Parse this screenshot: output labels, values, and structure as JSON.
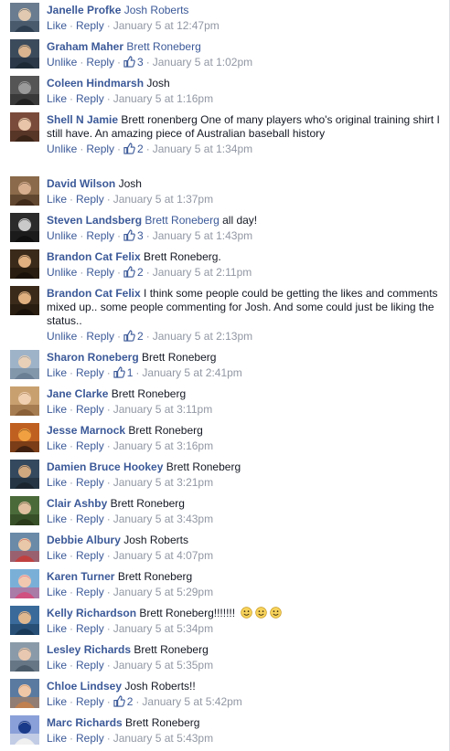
{
  "colors": {
    "link": "#3b5998",
    "meta": "#9197a3",
    "text": "#141823"
  },
  "comments": [
    {
      "author": "Janelle Profke",
      "mention": "Josh Roberts",
      "text": "",
      "action": "Like",
      "reply": "Reply",
      "likes": "",
      "time": "January 5 at 12:47pm",
      "avatar": [
        "#6a7c8f",
        "#e0c9b0",
        "#2c3e50"
      ]
    },
    {
      "author": "Graham Maher",
      "mention": "Brett Roneberg",
      "text": "",
      "action": "Unlike",
      "reply": "Reply",
      "likes": "3",
      "time": "January 5 at 1:02pm",
      "avatar": [
        "#3c4b5c",
        "#d9b48f",
        "#1d2a36"
      ]
    },
    {
      "author": "Coleen Hindmarsh",
      "mention": "",
      "text": "Josh",
      "action": "Like",
      "reply": "Reply",
      "likes": "",
      "time": "January 5 at 1:16pm",
      "avatar": [
        "#555555",
        "#9a9a9a",
        "#222222"
      ]
    },
    {
      "author": "Shell N Jamie",
      "mention": "",
      "text": "Brett ronenberg One of many players who's original training shirt I still have. An amazing piece of Australian baseball history",
      "action": "Unlike",
      "reply": "Reply",
      "likes": "2",
      "time": "January 5 at 1:34pm",
      "avatar": [
        "#7a4b3a",
        "#e8c4a8",
        "#3a2418"
      ]
    },
    {
      "author": "David Wilson",
      "mention": "",
      "text": "Josh",
      "action": "Like",
      "reply": "Reply",
      "likes": "",
      "time": "January 5 at 1:37pm",
      "avatar": [
        "#8a6a4a",
        "#d8b090",
        "#402a1a"
      ]
    },
    {
      "author": "Steven Landsberg",
      "mention": "Brett Roneberg",
      "text": "all day!",
      "action": "Unlike",
      "reply": "Reply",
      "likes": "3",
      "time": "January 5 at 1:43pm",
      "avatar": [
        "#2b2b2b",
        "#c9c9c9",
        "#0f0f0f"
      ]
    },
    {
      "author": "Brandon Cat Felix",
      "mention": "",
      "text": "Brett Roneberg.",
      "action": "Unlike",
      "reply": "Reply",
      "likes": "2",
      "time": "January 5 at 2:11pm",
      "avatar": [
        "#3a2a1a",
        "#e0b080",
        "#1a120a"
      ]
    },
    {
      "author": "Brandon Cat Felix",
      "mention": "",
      "text": "I think some people could be getting the likes and comments mixed up.. some people commenting for Josh. And some could just be liking the status..",
      "action": "Unlike",
      "reply": "Reply",
      "likes": "2",
      "time": "January 5 at 2:13pm",
      "avatar": [
        "#3a2a1a",
        "#e0b080",
        "#1a120a"
      ]
    },
    {
      "author": "Sharon Roneberg",
      "mention": "",
      "text": "Brett Roneberg",
      "action": "Like",
      "reply": "Reply",
      "likes": "1",
      "time": "January 5 at 2:41pm",
      "avatar": [
        "#9fb3c8",
        "#e8d0b8",
        "#6b7f94"
      ]
    },
    {
      "author": "Jane Clarke",
      "mention": "",
      "text": "Brett Roneberg",
      "action": "Like",
      "reply": "Reply",
      "likes": "",
      "time": "January 5 at 3:11pm",
      "avatar": [
        "#c8a070",
        "#f0d0b0",
        "#8a6038"
      ]
    },
    {
      "author": "Jesse Marnock",
      "mention": "",
      "text": "Brett Roneberg",
      "action": "Like",
      "reply": "Reply",
      "likes": "",
      "time": "January 5 at 3:16pm",
      "avatar": [
        "#c06020",
        "#f0a040",
        "#402010"
      ]
    },
    {
      "author": "Damien Bruce Hookey",
      "mention": "",
      "text": "Brett Roneberg",
      "action": "Like",
      "reply": "Reply",
      "likes": "",
      "time": "January 5 at 3:21pm",
      "avatar": [
        "#34495e",
        "#d0a880",
        "#1a252f"
      ]
    },
    {
      "author": "Clair Ashby",
      "mention": "",
      "text": "Brett Roneberg",
      "action": "Like",
      "reply": "Reply",
      "likes": "",
      "time": "January 5 at 3:43pm",
      "avatar": [
        "#4a6a3a",
        "#e0c0a0",
        "#2a3a1a"
      ]
    },
    {
      "author": "Debbie Albury",
      "mention": "",
      "text": "Josh Roberts",
      "action": "Like",
      "reply": "Reply",
      "likes": "",
      "time": "January 5 at 4:07pm",
      "avatar": [
        "#6a8aa8",
        "#e8c8a8",
        "#c04040"
      ]
    },
    {
      "author": "Karen Turner",
      "mention": "",
      "text": "Brett Roneberg",
      "action": "Like",
      "reply": "Reply",
      "likes": "",
      "time": "January 5 at 5:29pm",
      "avatar": [
        "#7ab0d8",
        "#f0c8b0",
        "#d05080"
      ]
    },
    {
      "author": "Kelly Richardson",
      "mention": "",
      "text": "Brett Roneberg!!!!!!!",
      "action": "Like",
      "reply": "Reply",
      "likes": "",
      "time": "January 5 at 5:34pm",
      "emojis": 3,
      "avatar": [
        "#3a6a9a",
        "#e0b890",
        "#1a3a5a"
      ]
    },
    {
      "author": "Lesley Richards",
      "mention": "",
      "text": "Brett Roneberg",
      "action": "Like",
      "reply": "Reply",
      "likes": "",
      "time": "January 5 at 5:35pm",
      "avatar": [
        "#8a9aa8",
        "#e8c8b0",
        "#4a5a68"
      ]
    },
    {
      "author": "Chloe Lindsey",
      "mention": "",
      "text": "Josh Roberts!!",
      "action": "Like",
      "reply": "Reply",
      "likes": "2",
      "time": "January 5 at 5:42pm",
      "avatar": [
        "#5a7aa0",
        "#f0c8a8",
        "#c08050"
      ]
    },
    {
      "author": "Marc Richards",
      "mention": "",
      "text": "Brett Roneberg",
      "action": "Like",
      "reply": "Reply",
      "likes": "",
      "time": "January 5 at 5:43pm",
      "avatar": [
        "#8aa0d8",
        "#1a3a8a",
        "#f0f0f0"
      ]
    }
  ]
}
